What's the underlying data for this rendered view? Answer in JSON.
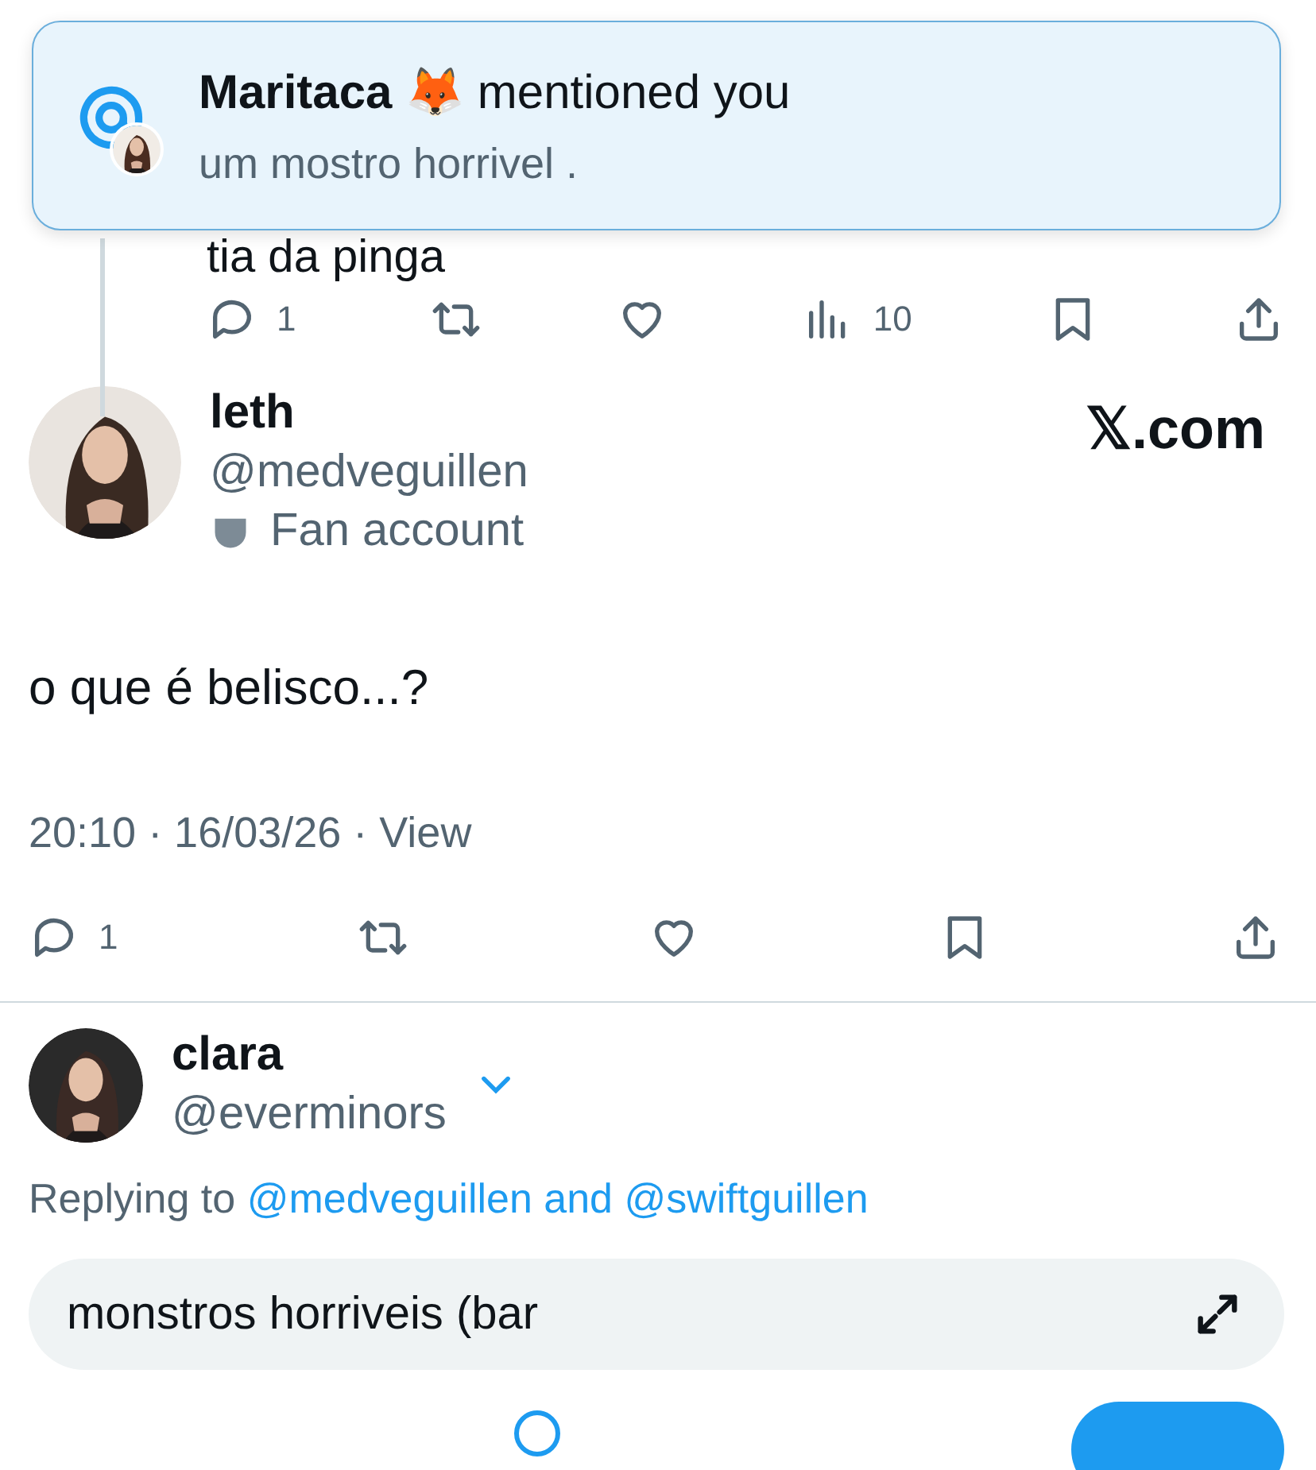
{
  "notification": {
    "name": "Maritaca 🦊",
    "action": "mentioned you",
    "text": "um mostro horrivel ."
  },
  "parent_tweet": {
    "text": "tia da pinga",
    "actions": [
      {
        "kind": "reply",
        "count": "1"
      },
      {
        "kind": "retweet"
      },
      {
        "kind": "like"
      },
      {
        "kind": "views",
        "count": "10"
      },
      {
        "kind": "bookmark"
      },
      {
        "kind": "share"
      }
    ]
  },
  "tweet": {
    "name": "leth",
    "handle": "@medveguillen",
    "label": "Fan account",
    "brand": "𝕏.com",
    "text": "o que é belisco...?",
    "meta": "20:10 · 16/03/26 · View",
    "actions": [
      {
        "kind": "reply",
        "count": "1"
      },
      {
        "kind": "retweet"
      },
      {
        "kind": "like"
      },
      {
        "kind": "bookmark"
      },
      {
        "kind": "share"
      }
    ]
  },
  "composer": {
    "name": "clara",
    "handle": "@everminors",
    "replying_prefix": "Replying to",
    "replying_to": "@medveguillen and @swiftguillen",
    "value": "monstros horriveis (bar"
  }
}
